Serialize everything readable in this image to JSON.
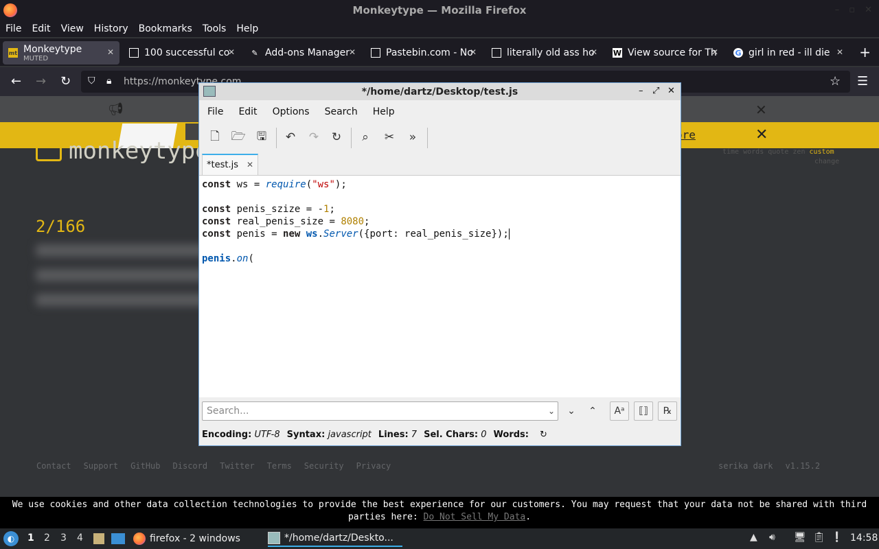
{
  "firefox": {
    "window_title": "Monkeytype — Mozilla Firefox",
    "menu": [
      "File",
      "Edit",
      "View",
      "History",
      "Bookmarks",
      "Tools",
      "Help"
    ],
    "tabs": [
      {
        "label": "Monkeytype",
        "sub": "MUTED",
        "icon": "mt"
      },
      {
        "label": "100 successful co",
        "icon": "grid"
      },
      {
        "label": "Add-ons Manager",
        "icon": "puzzle"
      },
      {
        "label": "Pastebin.com - No",
        "icon": "grid"
      },
      {
        "label": "literally old ass ho",
        "icon": "grid"
      },
      {
        "label": "View source for Th",
        "icon": "W"
      },
      {
        "label": "girl in red - ill die",
        "icon": "G"
      }
    ],
    "url": "https://monkeytype.com"
  },
  "page": {
    "more_link": "ore",
    "logo_text": "monkeytype",
    "modes": [
      "time",
      "words",
      "quote",
      "zen",
      "custom"
    ],
    "change_label": "change",
    "word_count": "2/166",
    "footer_left": [
      "Contact",
      "Support",
      "GitHub",
      "Discord",
      "Twitter",
      "Terms",
      "Security",
      "Privacy"
    ],
    "theme": "serika dark",
    "version": "v1.15.2",
    "cookie_text": "We use cookies and other data collection technologies to provide the best experience for our customers. You may request that your data not be shared with third parties here: ",
    "cookie_link": "Do Not Sell My Data",
    "cookie_end": "."
  },
  "editor": {
    "title": "*/home/dartz/Desktop/test.js",
    "menu": [
      "File",
      "Edit",
      "Options",
      "Search",
      "Help"
    ],
    "tab_label": "*test.js",
    "search_placeholder": "Search...",
    "status": {
      "encoding_label": "Encoding:",
      "encoding": "UTF-8",
      "syntax_label": "Syntax:",
      "syntax": "javascript",
      "lines_label": "Lines:",
      "lines": "7",
      "sel_label": "Sel. Chars:",
      "sel": "0",
      "words_label": "Words:"
    },
    "code": {
      "l1": {
        "kw": "const",
        "a": " ws = ",
        "fn": "require",
        "b": "(",
        "str": "\"ws\"",
        "c": ");"
      },
      "l3": {
        "kw": "const",
        "a": " penis_szize = -",
        "num": "1",
        "c": ";"
      },
      "l4": {
        "kw": "const",
        "a": " real_penis_size = ",
        "num": "8080",
        "c": ";"
      },
      "l5": {
        "kw": "const",
        "a": " penis = ",
        "kw2": "new",
        "sp": " ",
        "obj": "ws",
        "dot": ".",
        "fn": "Server",
        "c": "({port: real_penis_size});"
      },
      "l7": {
        "obj": "penis",
        "dot": ".",
        "fn": "on",
        "c": "("
      }
    }
  },
  "taskbar": {
    "workspaces": [
      "1",
      "2",
      "3",
      "4"
    ],
    "firefox_item": "firefox - 2 windows",
    "editor_item": "*/home/dartz/Deskto...",
    "clock": "14:58"
  }
}
